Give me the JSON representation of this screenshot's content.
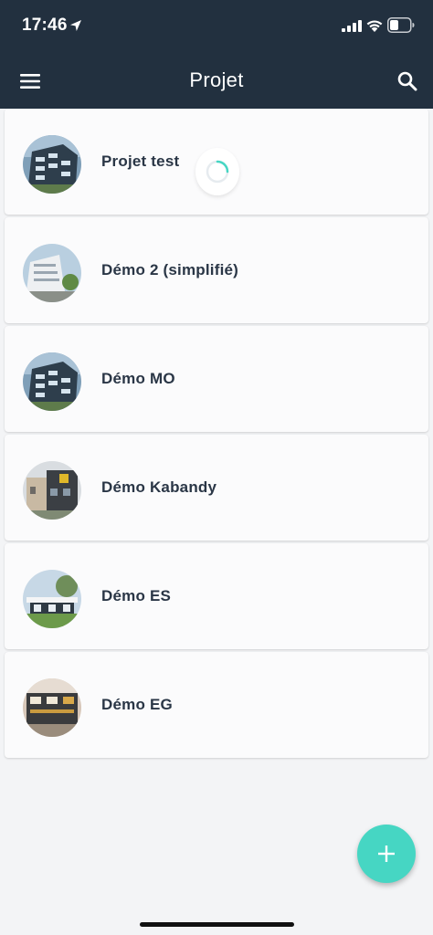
{
  "status_bar": {
    "time": "17:46",
    "icons": [
      "location-arrow-icon",
      "signal-icon",
      "wifi-icon",
      "battery-icon"
    ]
  },
  "app_bar": {
    "title": "Projet",
    "menu_icon": "hamburger-menu-icon",
    "search_icon": "search-icon",
    "background": "#22303f"
  },
  "projects": [
    {
      "name": "Projet test",
      "thumbnail": "building-photo-icon"
    },
    {
      "name": "Démo 2 (simplifié)",
      "thumbnail": "building-photo-icon"
    },
    {
      "name": "Démo MO",
      "thumbnail": "building-photo-icon"
    },
    {
      "name": "Démo Kabandy",
      "thumbnail": "building-photo-icon"
    },
    {
      "name": "Démo ES",
      "thumbnail": "building-photo-icon"
    },
    {
      "name": "Démo EG",
      "thumbnail": "building-photo-icon"
    }
  ],
  "loading_spinner": {
    "icon": "spinner-icon",
    "color": "#46d6c3"
  },
  "fab": {
    "icon": "plus-icon",
    "color": "#46d6c3"
  }
}
